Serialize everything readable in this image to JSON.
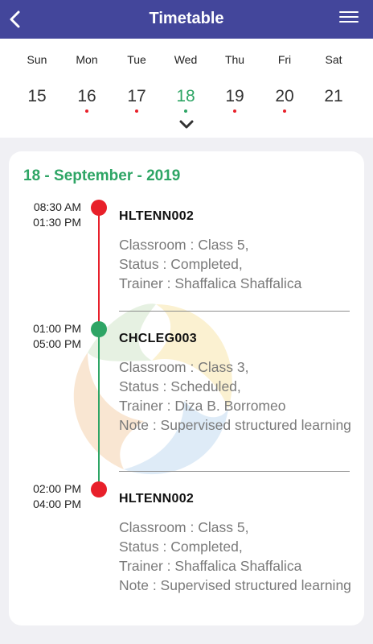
{
  "header": {
    "title": "Timetable",
    "back_icon": "chevron-left-icon",
    "menu_icon": "hamburger-menu-icon"
  },
  "week": {
    "days": [
      {
        "name": "Sun",
        "num": "15",
        "dot": ""
      },
      {
        "name": "Mon",
        "num": "16",
        "dot": "red"
      },
      {
        "name": "Tue",
        "num": "17",
        "dot": "red"
      },
      {
        "name": "Wed",
        "num": "18",
        "dot": "green"
      },
      {
        "name": "Thu",
        "num": "19",
        "dot": "red"
      },
      {
        "name": "Fri",
        "num": "20",
        "dot": "red"
      },
      {
        "name": "Sat",
        "num": "21",
        "dot": ""
      }
    ],
    "selected": "18",
    "expand_icon": "chevron-down-icon"
  },
  "schedule": {
    "date": "18 - September - 2019",
    "entries": [
      {
        "start": "08:30 AM",
        "end": "01:30 PM",
        "code": "HLTENN002",
        "classroom": "Classroom : Class 5,",
        "status": "Status : Completed,",
        "trainer": "Trainer : Shaffalica Shaffalica",
        "note": "",
        "status_color": "red"
      },
      {
        "start": "01:00 PM",
        "end": "05:00 PM",
        "code": "CHCLEG003",
        "classroom": "Classroom : Class 3,",
        "status": "Status : Scheduled,",
        "trainer": "Trainer : Diza B. Borromeo",
        "note": "Note : Supervised structured learning",
        "status_color": "green"
      },
      {
        "start": "02:00 PM",
        "end": "04:00 PM",
        "code": "HLTENN002",
        "classroom": "Classroom : Class 5,",
        "status": "Status : Completed,",
        "trainer": "Trainer : Shaffalica Shaffalica",
        "note": "Note : Supervised structured learning",
        "status_color": "red"
      }
    ]
  },
  "colors": {
    "header": "#43469b",
    "accent": "#2ea565",
    "alert": "#e8202a"
  }
}
